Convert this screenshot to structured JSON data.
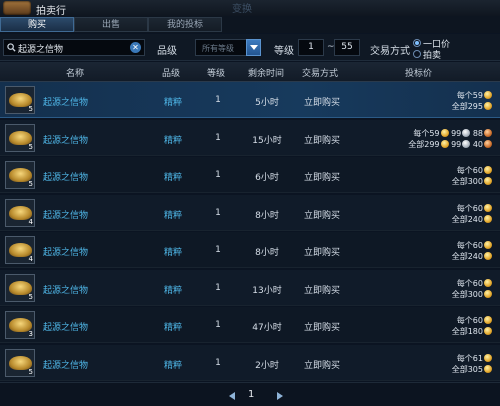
{
  "window": {
    "title": "拍卖行",
    "ghost_label": "变换"
  },
  "tabs": [
    {
      "label": "购买",
      "active": true
    },
    {
      "label": "出售",
      "active": false
    },
    {
      "label": "我的投标",
      "active": false
    }
  ],
  "filters": {
    "search_value": "起源之信物",
    "quality_label": "品级",
    "quality_value": "所有等级",
    "level_label": "等级",
    "level_min": "1",
    "level_sep": "~",
    "level_max": "55",
    "trade_label": "交易方式",
    "trade_options": [
      {
        "label": "一口价",
        "selected": true
      },
      {
        "label": "拍卖",
        "selected": false
      }
    ]
  },
  "columns": [
    "名称",
    "品级",
    "等级",
    "剩余时间",
    "交易方式",
    "投标价"
  ],
  "rows": [
    {
      "name": "起源之信物",
      "count": "5",
      "grade": "精粹",
      "level": "1",
      "time": "5小时",
      "type": "立即购买",
      "price_lines": [
        [
          "每个59",
          "gold"
        ],
        [
          "全部295",
          "gold"
        ]
      ]
    },
    {
      "name": "起源之信物",
      "count": "5",
      "grade": "精粹",
      "level": "1",
      "time": "15小时",
      "type": "立即购买",
      "price_lines": [
        [
          "每个59",
          "gold",
          "99",
          "silver",
          "88",
          "copper"
        ],
        [
          "全部299",
          "gold",
          "99",
          "silver",
          "40",
          "copper"
        ]
      ]
    },
    {
      "name": "起源之信物",
      "count": "5",
      "grade": "精粹",
      "level": "1",
      "time": "6小时",
      "type": "立即购买",
      "price_lines": [
        [
          "每个60",
          "gold"
        ],
        [
          "全部300",
          "gold"
        ]
      ]
    },
    {
      "name": "起源之信物",
      "count": "4",
      "grade": "精粹",
      "level": "1",
      "time": "8小时",
      "type": "立即购买",
      "price_lines": [
        [
          "每个60",
          "gold"
        ],
        [
          "全部240",
          "gold"
        ]
      ]
    },
    {
      "name": "起源之信物",
      "count": "4",
      "grade": "精粹",
      "level": "1",
      "time": "8小时",
      "type": "立即购买",
      "price_lines": [
        [
          "每个60",
          "gold"
        ],
        [
          "全部240",
          "gold"
        ]
      ]
    },
    {
      "name": "起源之信物",
      "count": "5",
      "grade": "精粹",
      "level": "1",
      "time": "13小时",
      "type": "立即购买",
      "price_lines": [
        [
          "每个60",
          "gold"
        ],
        [
          "全部300",
          "gold"
        ]
      ]
    },
    {
      "name": "起源之信物",
      "count": "3",
      "grade": "精粹",
      "level": "1",
      "time": "47小时",
      "type": "立即购买",
      "price_lines": [
        [
          "每个60",
          "gold"
        ],
        [
          "全部180",
          "gold"
        ]
      ]
    },
    {
      "name": "起源之信物",
      "count": "5",
      "grade": "精粹",
      "level": "1",
      "time": "2小时",
      "type": "立即购买",
      "price_lines": [
        [
          "每个61",
          "gold"
        ],
        [
          "全部305",
          "gold"
        ]
      ]
    }
  ],
  "pagination": {
    "page": "1"
  }
}
